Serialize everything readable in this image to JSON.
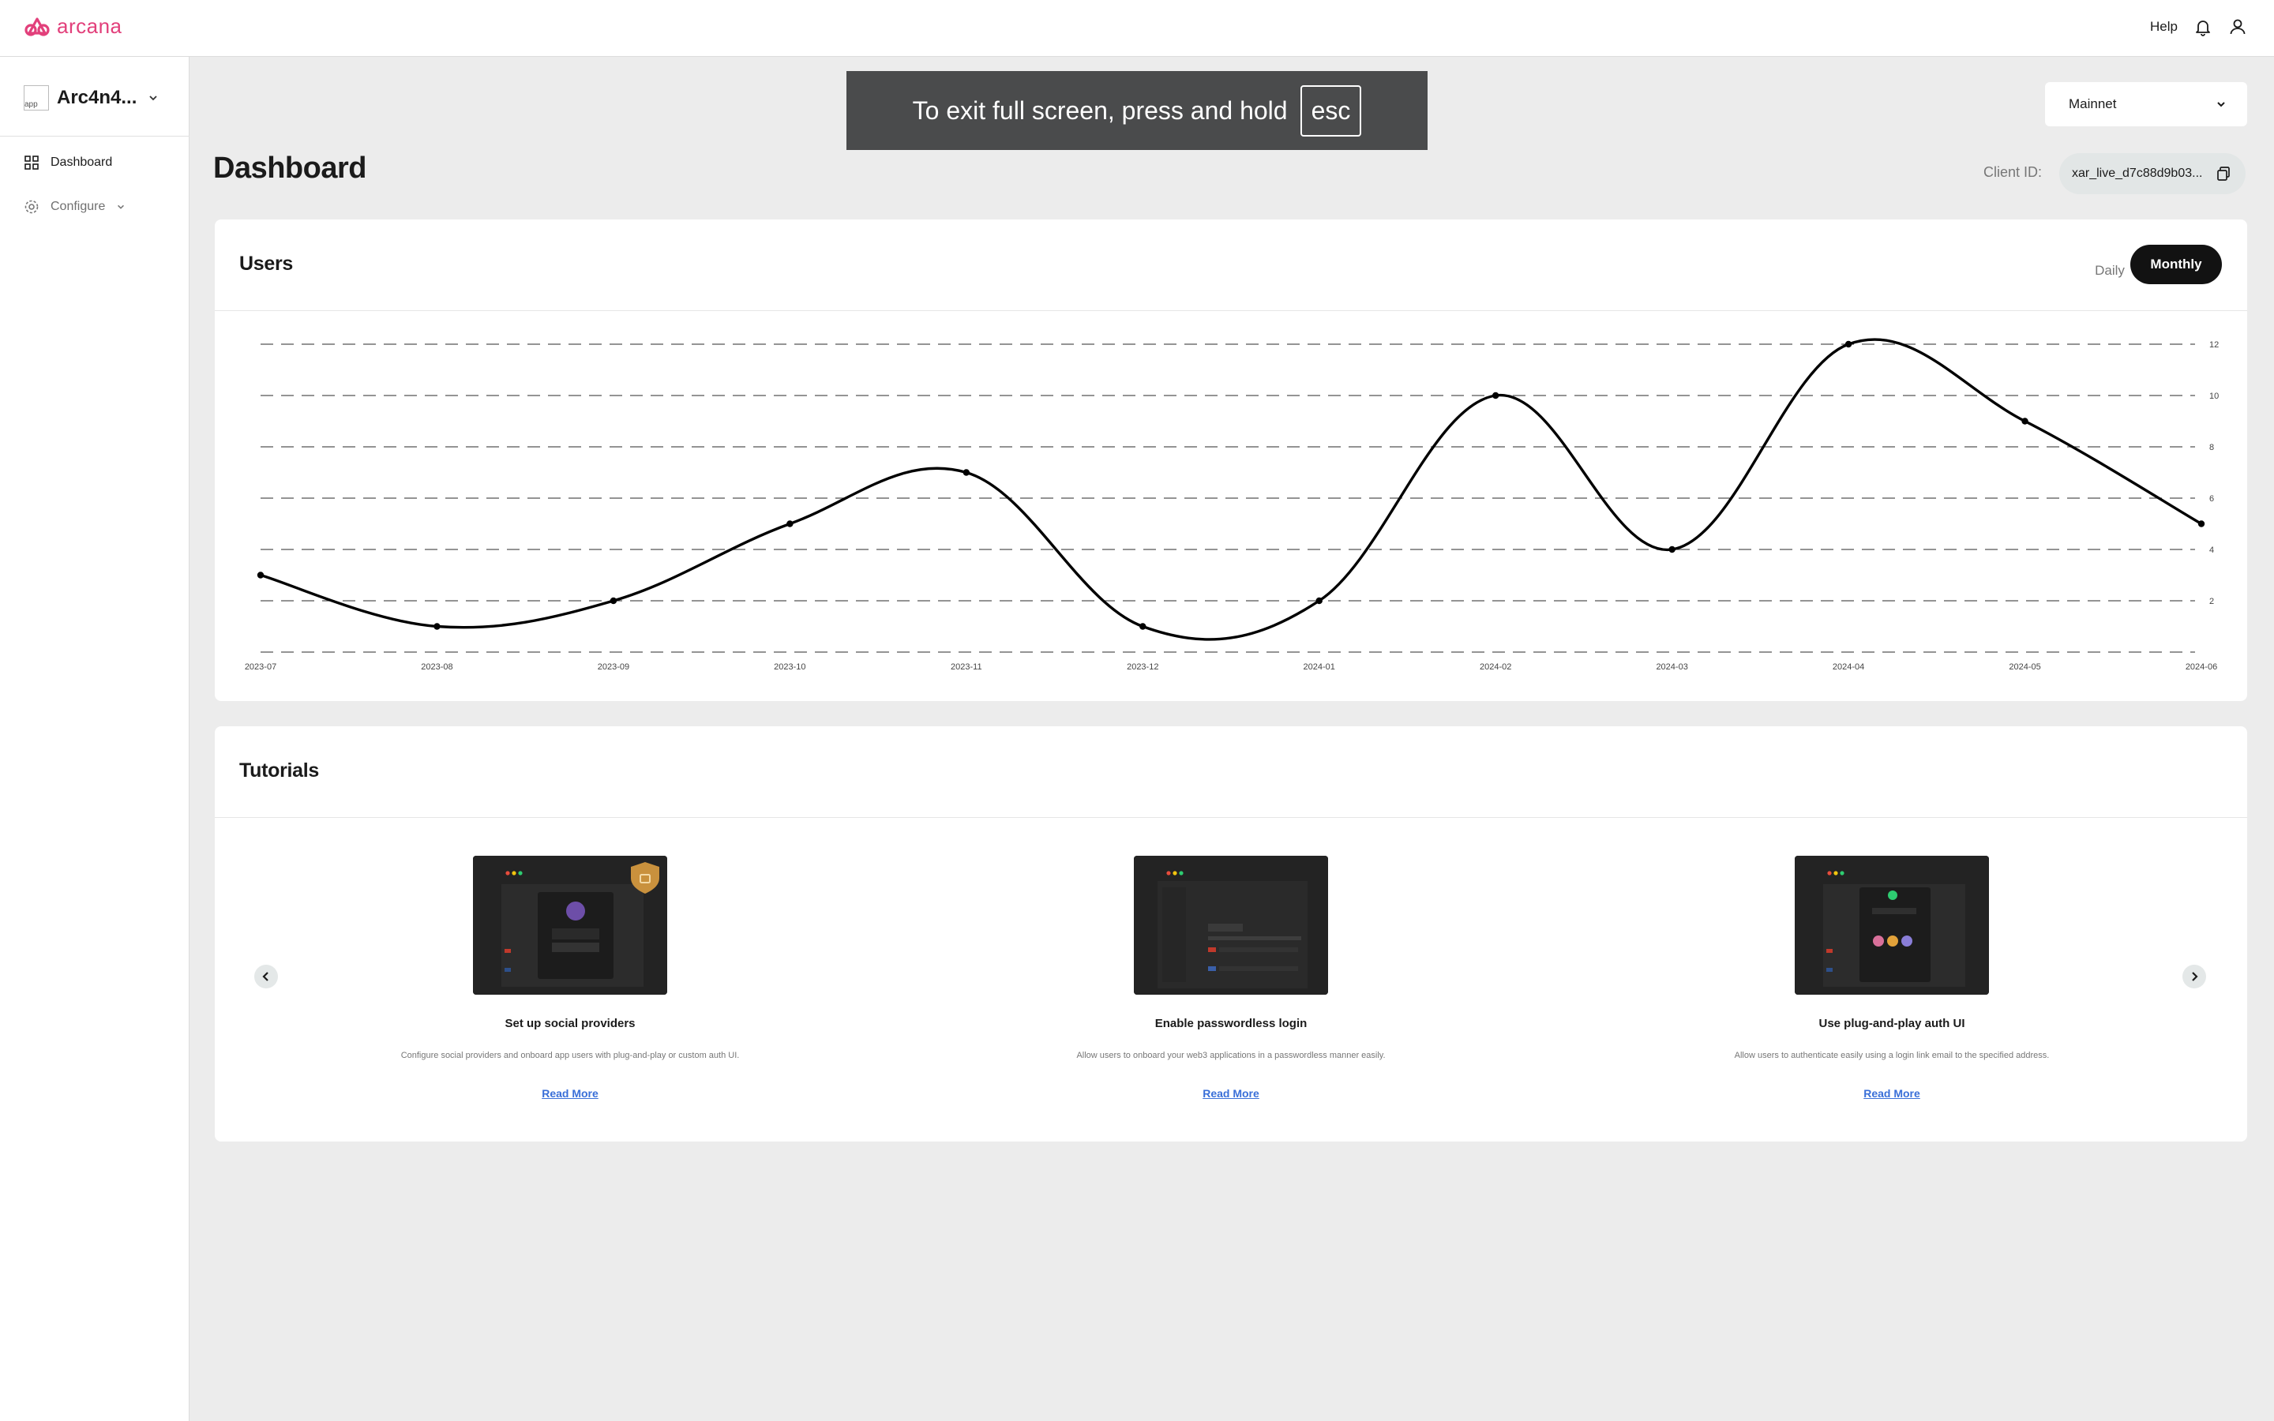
{
  "brand": {
    "name": "arcana",
    "color": "#e2407b"
  },
  "topbar": {
    "help_label": "Help",
    "icons": [
      "bell-icon",
      "user-icon"
    ]
  },
  "sidebar": {
    "app_name": "Arc4n4...",
    "app_image_alt": "app",
    "items": [
      {
        "label": "Dashboard",
        "icon": "grid-icon",
        "active": true
      },
      {
        "label": "Configure",
        "icon": "gear-icon",
        "expandable": true
      }
    ]
  },
  "fullscreen_toast": {
    "text": "To exit full screen, press and hold",
    "key": "esc"
  },
  "network_select": {
    "value": "Mainnet"
  },
  "page": {
    "title": "Dashboard"
  },
  "client": {
    "label": "Client ID:",
    "value": "xar_live_d7c88d9b03..."
  },
  "users": {
    "title": "Users",
    "toggle": {
      "daily": "Daily",
      "monthly": "Monthly",
      "selected": "Monthly"
    }
  },
  "chart_data": {
    "type": "line",
    "x": [
      "2023-07",
      "2023-08",
      "2023-09",
      "2023-10",
      "2023-11",
      "2023-12",
      "2024-01",
      "2024-02",
      "2024-03",
      "2024-04",
      "2024-05",
      "2024-06"
    ],
    "series": [
      {
        "values": [
          3,
          1,
          2,
          5,
          7,
          1,
          2,
          10,
          4,
          12,
          9,
          5
        ]
      }
    ],
    "yticks": [
      "2",
      "4",
      "6",
      "8",
      "10",
      "12"
    ],
    "ylim": [
      0,
      12
    ],
    "y_axis_side": "right",
    "grid": "dashed-horizontal",
    "title": "",
    "xlabel": "",
    "ylabel": "",
    "line_color": "#000000"
  },
  "tutorials": {
    "title": "Tutorials",
    "items": [
      {
        "title": "Set up social providers",
        "description": "Configure social providers and onboard app users with plug-and-play or custom auth UI.",
        "link": "Read More"
      },
      {
        "title": "Enable passwordless login",
        "description": "Allow users to onboard your web3 applications in a passwordless manner easily.",
        "link": "Read More"
      },
      {
        "title": "Use plug-and-play auth UI",
        "description": "Allow users to authenticate easily using a login link email to the specified address.",
        "link": "Read More"
      }
    ]
  }
}
